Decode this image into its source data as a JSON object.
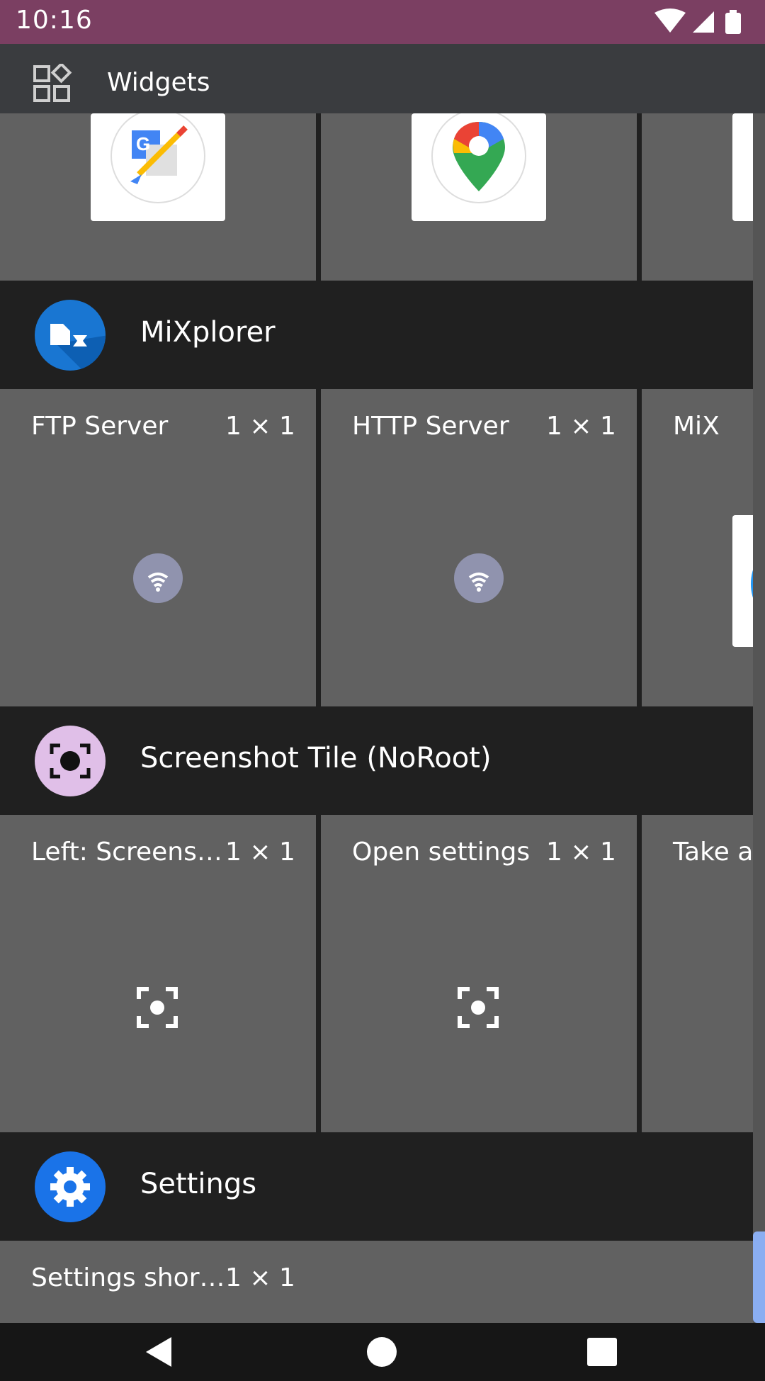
{
  "status_bar": {
    "time": "10:16",
    "icons": [
      "wifi-icon",
      "signal-icon",
      "battery-icon"
    ]
  },
  "toolbar": {
    "title": "Widgets",
    "icon": "widgets-icon"
  },
  "top_previews": [
    {
      "icon": "google-translate-icon"
    },
    {
      "icon": "google-maps-icon"
    }
  ],
  "sections": [
    {
      "app_name": "MiXplorer",
      "icon": "mixplorer-icon",
      "widgets": [
        {
          "label": "FTP Server",
          "size": "1 × 1",
          "icon": "wifi-icon"
        },
        {
          "label": "HTTP Server",
          "size": "1 × 1",
          "icon": "wifi-icon"
        },
        {
          "label": "MiX",
          "size": "",
          "icon": "mixplorer-icon"
        }
      ]
    },
    {
      "app_name": "Screenshot Tile (NoRoot)",
      "icon": "screenshot-tile-icon",
      "widgets": [
        {
          "label": "Left: Screens…",
          "size": "1 × 1",
          "icon": "screenshot-icon"
        },
        {
          "label": "Open settings",
          "size": "1 × 1",
          "icon": "screenshot-icon"
        },
        {
          "label": "Take a s",
          "size": "",
          "icon": "screenshot-icon"
        }
      ]
    },
    {
      "app_name": "Settings",
      "icon": "settings-gear-icon",
      "widgets": [
        {
          "label": "Settings shor…",
          "size": "1 × 1",
          "icon": "settings-icon"
        }
      ]
    }
  ],
  "nav_bar": {
    "buttons": [
      "back-button",
      "home-button",
      "recents-button"
    ]
  },
  "colors": {
    "status_bar": "#7b3f62",
    "toolbar": "#3a3c3f",
    "cell": "#616161",
    "header": "#202020",
    "accent": "#8aaef2"
  }
}
